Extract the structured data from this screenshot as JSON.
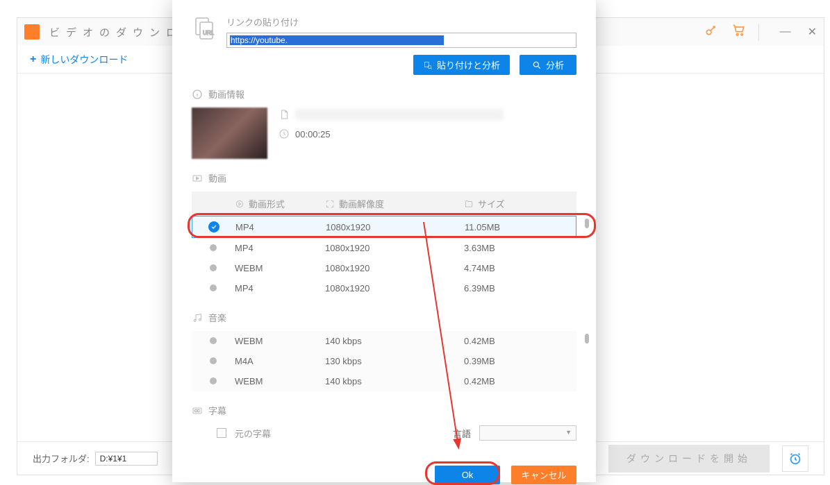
{
  "main": {
    "title": "ビデオのダウンロード",
    "new_download": "新しいダウンロード",
    "output_folder_label": "出力フォルダ:",
    "output_folder_path": "D:¥1¥1",
    "start_download": "ダウンロードを開始"
  },
  "modal": {
    "paste_label": "リンクの貼り付け",
    "url_prefix": "https://youtube.",
    "paste_analyze_btn": "貼り付けと分析",
    "analyze_btn": "分析",
    "info_section": "動画情報",
    "duration": "00:00:25",
    "video_section": "動画",
    "headers": {
      "format": "動画形式",
      "resolution": "動画解像度",
      "size": "サイズ"
    },
    "video_rows": [
      {
        "format": "MP4",
        "resolution": "1080x1920",
        "size": "11.05MB",
        "selected": true
      },
      {
        "format": "MP4",
        "resolution": "1080x1920",
        "size": "3.63MB",
        "selected": false
      },
      {
        "format": "WEBM",
        "resolution": "1080x1920",
        "size": "4.74MB",
        "selected": false
      },
      {
        "format": "MP4",
        "resolution": "1080x1920",
        "size": "6.39MB",
        "selected": false
      }
    ],
    "audio_section": "音楽",
    "audio_rows": [
      {
        "format": "WEBM",
        "bitrate": "140 kbps",
        "size": "0.42MB"
      },
      {
        "format": "M4A",
        "bitrate": "130 kbps",
        "size": "0.39MB"
      },
      {
        "format": "WEBM",
        "bitrate": "140 kbps",
        "size": "0.42MB"
      }
    ],
    "subtitle_section": "字幕",
    "original_subtitle": "元の字幕",
    "language_label": "言語",
    "ok_btn": "Ok",
    "cancel_btn": "キャンセル"
  }
}
